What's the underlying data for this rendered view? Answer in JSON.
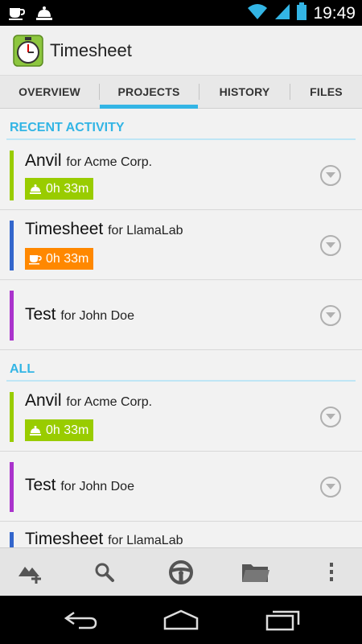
{
  "status_bar": {
    "time": "19:49",
    "left_icons": [
      "coffee-cup-icon",
      "service-bell-icon"
    ],
    "right_icons": [
      "wifi-icon",
      "signal-icon",
      "battery-icon"
    ]
  },
  "action_bar": {
    "app_icon": "stopwatch-app-icon",
    "title": "Timesheet"
  },
  "tabs": [
    {
      "label": "OVERVIEW",
      "active": false
    },
    {
      "label": "PROJECTS",
      "active": true
    },
    {
      "label": "HISTORY",
      "active": false
    },
    {
      "label": "FILES",
      "active": false
    }
  ],
  "sections": {
    "recent": {
      "label": "RECENT ACTIVITY",
      "items": [
        {
          "name": "Anvil",
          "client": "for Acme Corp.",
          "color": "#99cc00",
          "badge": {
            "icon": "service-bell-icon",
            "text": "0h 33m",
            "color": "#99cc00"
          }
        },
        {
          "name": "Timesheet",
          "client": "for LlamaLab",
          "color": "#3366cc",
          "badge": {
            "icon": "coffee-cup-icon",
            "text": "0h 33m",
            "color": "#ff8800"
          }
        },
        {
          "name": "Test",
          "client": "for John Doe",
          "color": "#aa33cc",
          "badge": null
        }
      ]
    },
    "all": {
      "label": "ALL",
      "items": [
        {
          "name": "Anvil",
          "client": "for Acme Corp.",
          "color": "#99cc00",
          "badge": {
            "icon": "service-bell-icon",
            "text": "0h 33m",
            "color": "#99cc00"
          }
        },
        {
          "name": "Test",
          "client": "for John Doe",
          "color": "#aa33cc",
          "badge": null
        },
        {
          "name": "Timesheet",
          "client": "for LlamaLab",
          "color": "#3366cc",
          "badge": null
        }
      ]
    }
  },
  "bottom_bar": {
    "buttons": [
      "add-project-icon",
      "search-icon",
      "steering-wheel-icon",
      "folder-icon",
      "overflow-menu-icon"
    ]
  },
  "nav_bar": {
    "buttons": [
      "back-icon",
      "home-icon",
      "recent-apps-icon"
    ]
  }
}
